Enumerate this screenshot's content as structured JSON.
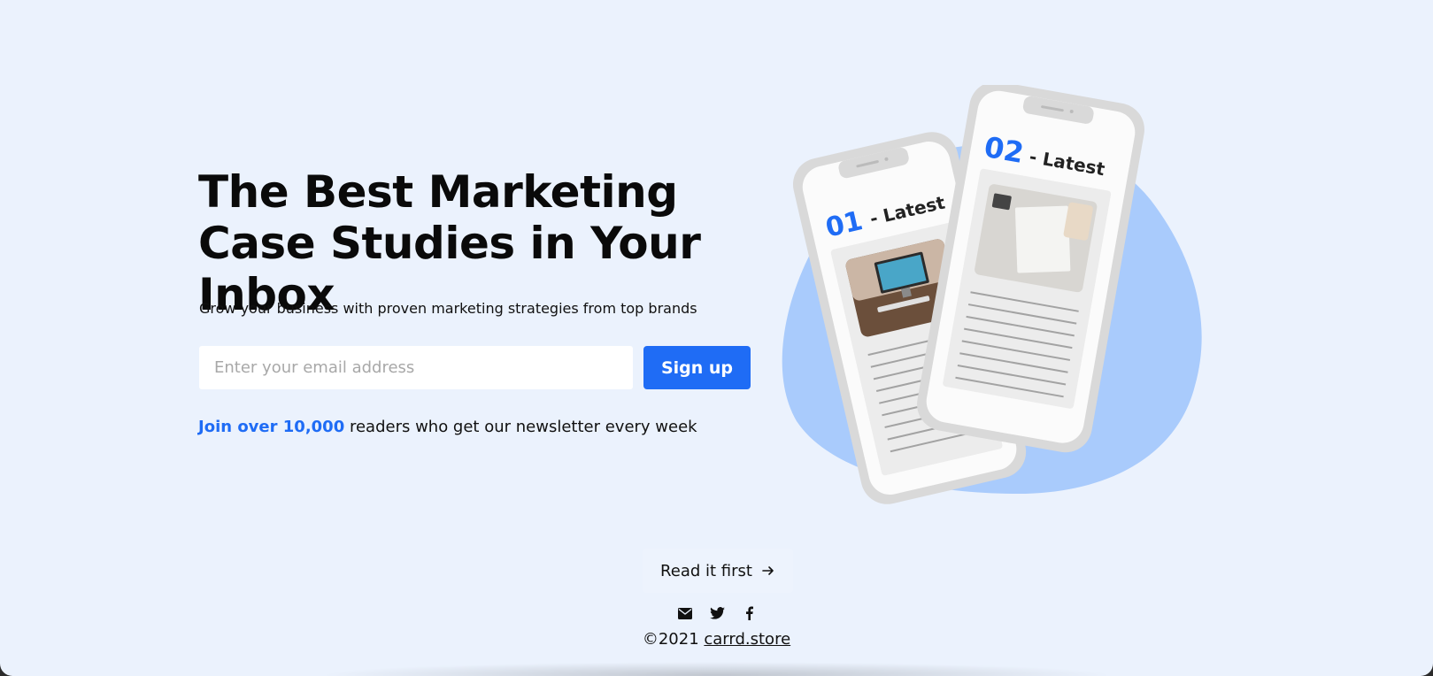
{
  "hero": {
    "title": "The Best Marketing Case Studies in Your Inbox",
    "subtitle": "Grow your business with proven marketing strategies from top brands"
  },
  "signup": {
    "email_placeholder": "Enter your email address",
    "button_label": "Sign up"
  },
  "social_proof": {
    "highlight": "Join over 10,000",
    "rest": " readers who get our newsletter every week"
  },
  "illustration": {
    "phone1": {
      "number": "01",
      "label": " - Latest"
    },
    "phone2": {
      "number": "02",
      "label": " - Latest"
    }
  },
  "cta": {
    "label": "Read it first",
    "icon": "arrow-right-icon"
  },
  "social_icons": [
    "envelope-icon",
    "twitter-icon",
    "facebook-icon"
  ],
  "footer": {
    "copyright": "©2021 ",
    "link_text": "carrd.store"
  },
  "colors": {
    "accent": "#1f6cf5",
    "background": "#ebf2fd",
    "blob": "#a9cbfc"
  }
}
